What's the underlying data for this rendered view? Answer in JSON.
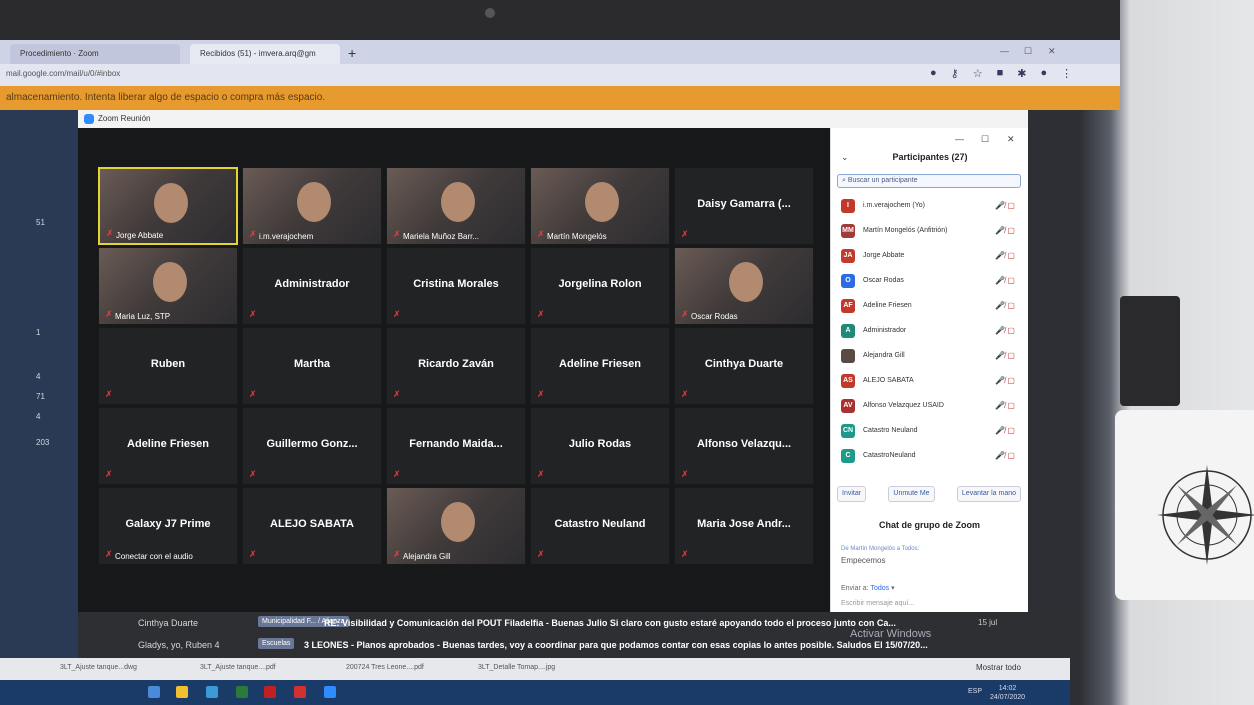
{
  "browser": {
    "tabs": [
      {
        "label": "Procedimiento · Zoom"
      },
      {
        "label": "Recibidos (51) - imvera.arq@gm"
      }
    ],
    "new_tab": "+",
    "url": "mail.google.com/mail/u/0/#inbox",
    "banner": "almacenamiento. Intenta liberar algo de espacio o compra más espacio."
  },
  "gmail_left": {
    "counts": [
      "51",
      "1",
      "4",
      "71",
      "4",
      "203"
    ]
  },
  "zoom": {
    "window_title": "Zoom Reunión",
    "tiles": [
      {
        "name": "",
        "label": "Jorge Abbate",
        "video": true,
        "selected": true
      },
      {
        "name": "",
        "label": "i.m.verajochem",
        "video": true
      },
      {
        "name": "",
        "label": "Mariela Muñoz Barr...",
        "video": true
      },
      {
        "name": "",
        "label": "Martín Mongelós",
        "video": true
      },
      {
        "name": "Daisy Gamarra (...",
        "label": "",
        "video": false
      },
      {
        "name": "",
        "label": "Maria Luz, STP",
        "video": true
      },
      {
        "name": "Administrador",
        "label": "",
        "video": false
      },
      {
        "name": "Cristina Morales",
        "label": "",
        "video": false
      },
      {
        "name": "Jorgelina Rolon",
        "label": "",
        "video": false
      },
      {
        "name": "",
        "label": "Oscar Rodas",
        "video": true
      },
      {
        "name": "Ruben",
        "label": "",
        "video": false
      },
      {
        "name": "Martha",
        "label": "",
        "video": false
      },
      {
        "name": "Ricardo Zaván",
        "label": "",
        "video": false
      },
      {
        "name": "Adeline Friesen",
        "label": "",
        "video": false
      },
      {
        "name": "Cinthya Duarte",
        "label": "",
        "video": false
      },
      {
        "name": "Adeline Friesen",
        "label": "",
        "video": false
      },
      {
        "name": "Guillermo Gonz...",
        "label": "",
        "video": false
      },
      {
        "name": "Fernando Maida...",
        "label": "",
        "video": false
      },
      {
        "name": "Julio Rodas",
        "label": "",
        "video": false
      },
      {
        "name": "Alfonso Velazqu...",
        "label": "",
        "video": false
      },
      {
        "name": "Galaxy J7 Prime",
        "label": "Conectar con el audio",
        "video": false
      },
      {
        "name": "ALEJO SABATA",
        "label": "",
        "video": false
      },
      {
        "name": "",
        "label": "Alejandra Gill",
        "video": true
      },
      {
        "name": "Catastro Neuland",
        "label": "",
        "video": false
      },
      {
        "name": "Maria Jose Andr...",
        "label": "",
        "video": false
      }
    ],
    "participants": {
      "title": "Participantes (27)",
      "search_placeholder": "Buscar un participante",
      "list": [
        {
          "initials": "I",
          "name": "i.m.verajochem (Yo)",
          "color": "#c0392b"
        },
        {
          "initials": "MM",
          "name": "Martín Mongelós (Anfitrión)",
          "color": "#a33a3a"
        },
        {
          "initials": "JA",
          "name": "Jorge Abbate",
          "color": "#c23b2a"
        },
        {
          "initials": "O",
          "name": "Oscar Rodas",
          "color": "#2d6be0"
        },
        {
          "initials": "AF",
          "name": "Adeline Friesen",
          "color": "#c0392b"
        },
        {
          "initials": "A",
          "name": "Administrador",
          "color": "#1f8a7a"
        },
        {
          "initials": "",
          "name": "Alejandra Gill",
          "color": "#5a4a44"
        },
        {
          "initials": "AS",
          "name": "ALEJO SABATA",
          "color": "#c0392b"
        },
        {
          "initials": "AV",
          "name": "Alfonso Velazquez USAID",
          "color": "#a83232"
        },
        {
          "initials": "CN",
          "name": "Catastro Neuland",
          "color": "#1f9a8a"
        },
        {
          "initials": "C",
          "name": "CatastroNeuland",
          "color": "#1f9a8a"
        }
      ],
      "buttons": [
        "Invitar",
        "Unmute Me",
        "Levantar la mano"
      ]
    },
    "chat": {
      "title": "Chat de grupo de Zoom",
      "from": "De Martín Mongelós a Todos:",
      "message": "Empecemos",
      "send_to_label": "Enviar a:",
      "send_to_value": "Todos",
      "input_placeholder": "Escribir mensaje aquí..."
    }
  },
  "mail_rows": [
    {
      "from": "Cinthya Duarte",
      "tag": "Municipalidad F... / Alianza",
      "subject": "RE: Visibilidad y Comunicación del POUT Filadelfia - Buenas Julio Si claro con gusto estaré apoyando todo el proceso junto con Ca...",
      "date": "15 jul"
    },
    {
      "from": "Gladys, yo, Ruben 4",
      "tag": "Escuelas",
      "subject": "3 LEONES - Planos aprobados - Buenas tardes, voy a coordinar para que podamos contar con esas copias lo antes posible. Saludos El 15/07/20...",
      "date": ""
    }
  ],
  "activate_windows": "Activar Windows",
  "downloads": {
    "items": [
      "3LT_Ajuste tanque...dwg",
      "3LT_Ajuste tanque....pdf",
      "200724 Tres Leone....pdf",
      "3LT_Detalle Tomap....jpg"
    ],
    "show_all": "Mostrar todo"
  },
  "taskbar": {
    "lang": "ESP",
    "time": "14:02",
    "date": "24/07/2020"
  }
}
